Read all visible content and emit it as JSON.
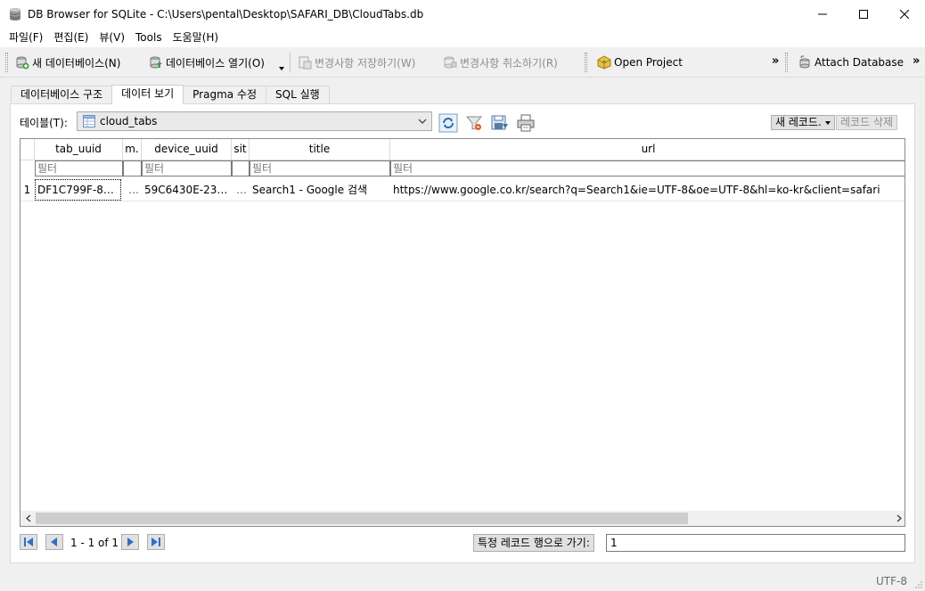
{
  "window": {
    "title": "DB Browser for SQLite - C:\\Users\\pental\\Desktop\\SAFARI_DB\\CloudTabs.db"
  },
  "menu": [
    "파일(F)",
    "편집(E)",
    "뷰(V)",
    "Tools",
    "도움말(H)"
  ],
  "toolbar": {
    "new_db": "새 데이터베이스(N)",
    "open_db": "데이터베이스 열기(O)",
    "write_changes": "변경사항 저장하기(W)",
    "revert_changes": "변경사항 취소하기(R)",
    "open_project": "Open Project",
    "attach_db": "Attach Database",
    "more": "»"
  },
  "tabs": [
    "데이터베이스 구조",
    "데이터 보기",
    "Pragma 수정",
    "SQL 실행"
  ],
  "browse": {
    "table_label": "테이블(T):",
    "table_selected": "cloud_tabs",
    "new_record": "새 레코드.",
    "delete_record": "레코드 삭제"
  },
  "grid": {
    "columns": [
      "tab_uuid",
      "m.",
      "device_uuid",
      "sit",
      "title",
      "url"
    ],
    "filter_placeholder": "필터",
    "rows": [
      {
        "num": "1",
        "cells": [
          "DF1C799F-8…",
          "…",
          "59C6430E-23…",
          "…",
          "Search1 - Google 검색",
          "https://www.google.co.kr/search?q=Search1&ie=UTF-8&oe=UTF-8&hl=ko-kr&client=safari"
        ]
      }
    ]
  },
  "nav": {
    "page_text": "1 - 1 of 1",
    "goto_label": "특정 레코드 행으로 가기:",
    "goto_value": "1"
  },
  "status": {
    "encoding": "UTF-8"
  }
}
